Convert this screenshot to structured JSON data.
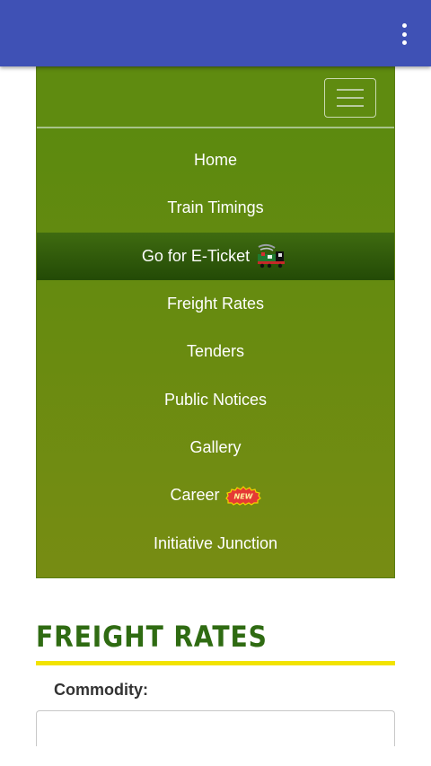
{
  "appbar": {
    "background": "#3f51b5",
    "overflow_icon": "more-vert-icon"
  },
  "navbar": {
    "background": "#5f8b10",
    "toggler_icon": "hamburger-menu-icon",
    "items": [
      {
        "label": "Home"
      },
      {
        "label": "Train Timings"
      },
      {
        "label": "Go for E-Ticket",
        "icon": "train-icon",
        "active": true
      },
      {
        "label": "Freight Rates"
      },
      {
        "label": "Tenders"
      },
      {
        "label": "Public Notices"
      },
      {
        "label": "Gallery"
      },
      {
        "label": "Career",
        "icon": "new-badge-icon",
        "badge_text": "NEW"
      },
      {
        "label": "Initiative Junction"
      }
    ]
  },
  "section": {
    "title": "FREIGHT RATES",
    "title_color": "#2f6b12",
    "rule_color": "#f2e300",
    "commodity_label": "Commodity:"
  }
}
